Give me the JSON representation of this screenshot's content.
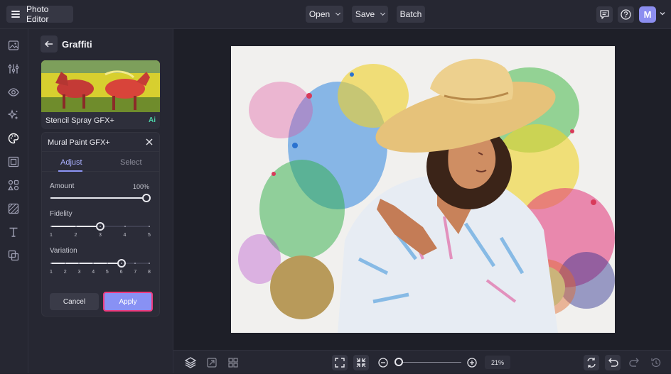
{
  "topbar": {
    "app_title": "Photo Editor",
    "open_label": "Open",
    "save_label": "Save",
    "batch_label": "Batch",
    "avatar_initial": "M"
  },
  "panel": {
    "title": "Graffiti",
    "preset": {
      "name": "Stencil Spray GFX+",
      "badge": "Ai"
    },
    "effect": {
      "name": "Mural Paint GFX+",
      "tabs": [
        "Adjust",
        "Select"
      ],
      "active_tab": "Adjust",
      "amount": {
        "label": "Amount",
        "value_text": "100%",
        "value": 100
      },
      "fidelity": {
        "label": "Fidelity",
        "ticks": [
          "1",
          "2",
          "3",
          "4",
          "5"
        ],
        "value": 3
      },
      "variation": {
        "label": "Variation",
        "ticks": [
          "1",
          "2",
          "3",
          "4",
          "5",
          "6",
          "7",
          "8"
        ],
        "value": 6
      },
      "cancel_label": "Cancel",
      "apply_label": "Apply"
    }
  },
  "bottombar": {
    "zoom_text": "21%",
    "zoom_level": 0.21
  },
  "colors": {
    "accent": "#8891f4",
    "apply_highlight": "#ee3b7e",
    "ai_badge": "#4cd0a6",
    "background": "#22232d"
  },
  "icons": {
    "rail": [
      "image-icon",
      "adjustments-icon",
      "eye-icon",
      "sparkle-effects-icon",
      "palette-icon",
      "frame-icon",
      "graphics-icon",
      "texture-icon",
      "text-icon",
      "overlay-icon"
    ],
    "top_right": [
      "feedback-icon",
      "help-icon"
    ],
    "bottom_left": [
      "layers-icon",
      "resize-icon",
      "grid-icon"
    ],
    "bottom_center": [
      "fit-screen-icon",
      "actual-size-icon",
      "zoom-out-icon",
      "zoom-in-icon"
    ],
    "bottom_right": [
      "compare-icon",
      "undo-icon",
      "redo-icon",
      "history-icon"
    ]
  }
}
